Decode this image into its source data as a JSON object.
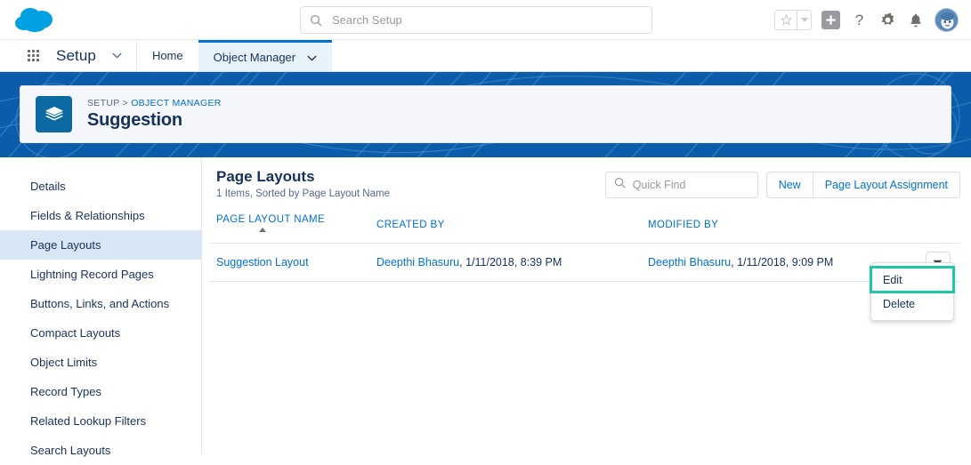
{
  "global_header": {
    "logo_name": "salesforce-cloud-logo",
    "search": {
      "placeholder": "Search Setup",
      "value": ""
    },
    "icons": [
      {
        "name": "favorites-star-icon",
        "glyph": "☆"
      },
      {
        "name": "favorites-caret-icon",
        "glyph": "▾"
      },
      {
        "name": "add-icon",
        "glyph": "+"
      },
      {
        "name": "help-icon",
        "glyph": "?"
      },
      {
        "name": "setup-gear-icon",
        "glyph": "⚙"
      },
      {
        "name": "notifications-bell-icon",
        "glyph": "🔔"
      },
      {
        "name": "user-avatar",
        "glyph": ""
      }
    ]
  },
  "nav": {
    "app_launcher_label": "app-launcher",
    "app_name": "Setup",
    "tabs": [
      {
        "label": "Home",
        "active": false,
        "has_caret": false
      },
      {
        "label": "Object Manager",
        "active": true,
        "has_caret": true
      }
    ]
  },
  "object_header": {
    "icon_name": "page-layouts-stack-icon",
    "breadcrumb_root": "SETUP",
    "breadcrumb_separator": ">",
    "breadcrumb_parent": "OBJECT MANAGER",
    "title": "Suggestion"
  },
  "sidebar": {
    "items": [
      {
        "label": "Details",
        "active": false
      },
      {
        "label": "Fields & Relationships",
        "active": false
      },
      {
        "label": "Page Layouts",
        "active": true
      },
      {
        "label": "Lightning Record Pages",
        "active": false
      },
      {
        "label": "Buttons, Links, and Actions",
        "active": false
      },
      {
        "label": "Compact Layouts",
        "active": false
      },
      {
        "label": "Object Limits",
        "active": false
      },
      {
        "label": "Record Types",
        "active": false
      },
      {
        "label": "Related Lookup Filters",
        "active": false
      },
      {
        "label": "Search Layouts",
        "active": false
      }
    ]
  },
  "main": {
    "title": "Page Layouts",
    "subtitle": "1 Items, Sorted by Page Layout Name",
    "quick_find": {
      "placeholder": "Quick Find",
      "value": ""
    },
    "buttons": [
      {
        "label": "New"
      },
      {
        "label": "Page Layout Assignment"
      }
    ],
    "table": {
      "columns": [
        {
          "label": "Page Layout Name",
          "sorted": true,
          "sort_dir": "asc"
        },
        {
          "label": "Created By",
          "sorted": false
        },
        {
          "label": "Modified By",
          "sorted": false
        }
      ],
      "rows": [
        {
          "name": "Suggestion Layout",
          "created_by_user": "Deepthi Bhasuru",
          "created_by_rest": ", 1/11/2018, 8:39 PM",
          "modified_by_user": "Deepthi Bhasuru",
          "modified_by_rest": ", 1/11/2018, 9:09 PM"
        }
      ]
    },
    "row_menu": {
      "items": [
        {
          "label": "Edit",
          "highlighted": true
        },
        {
          "label": "Delete",
          "highlighted": false
        }
      ]
    }
  },
  "colors": {
    "brand_blue": "#0070d2",
    "cloud_blue": "#00a1e0",
    "banner_blue": "#0b5cab",
    "object_icon_blue": "#0b6aa2",
    "highlight_teal": "#1ec8a5",
    "sidebar_active": "#d8e6f6",
    "text_navy": "#16325c"
  }
}
